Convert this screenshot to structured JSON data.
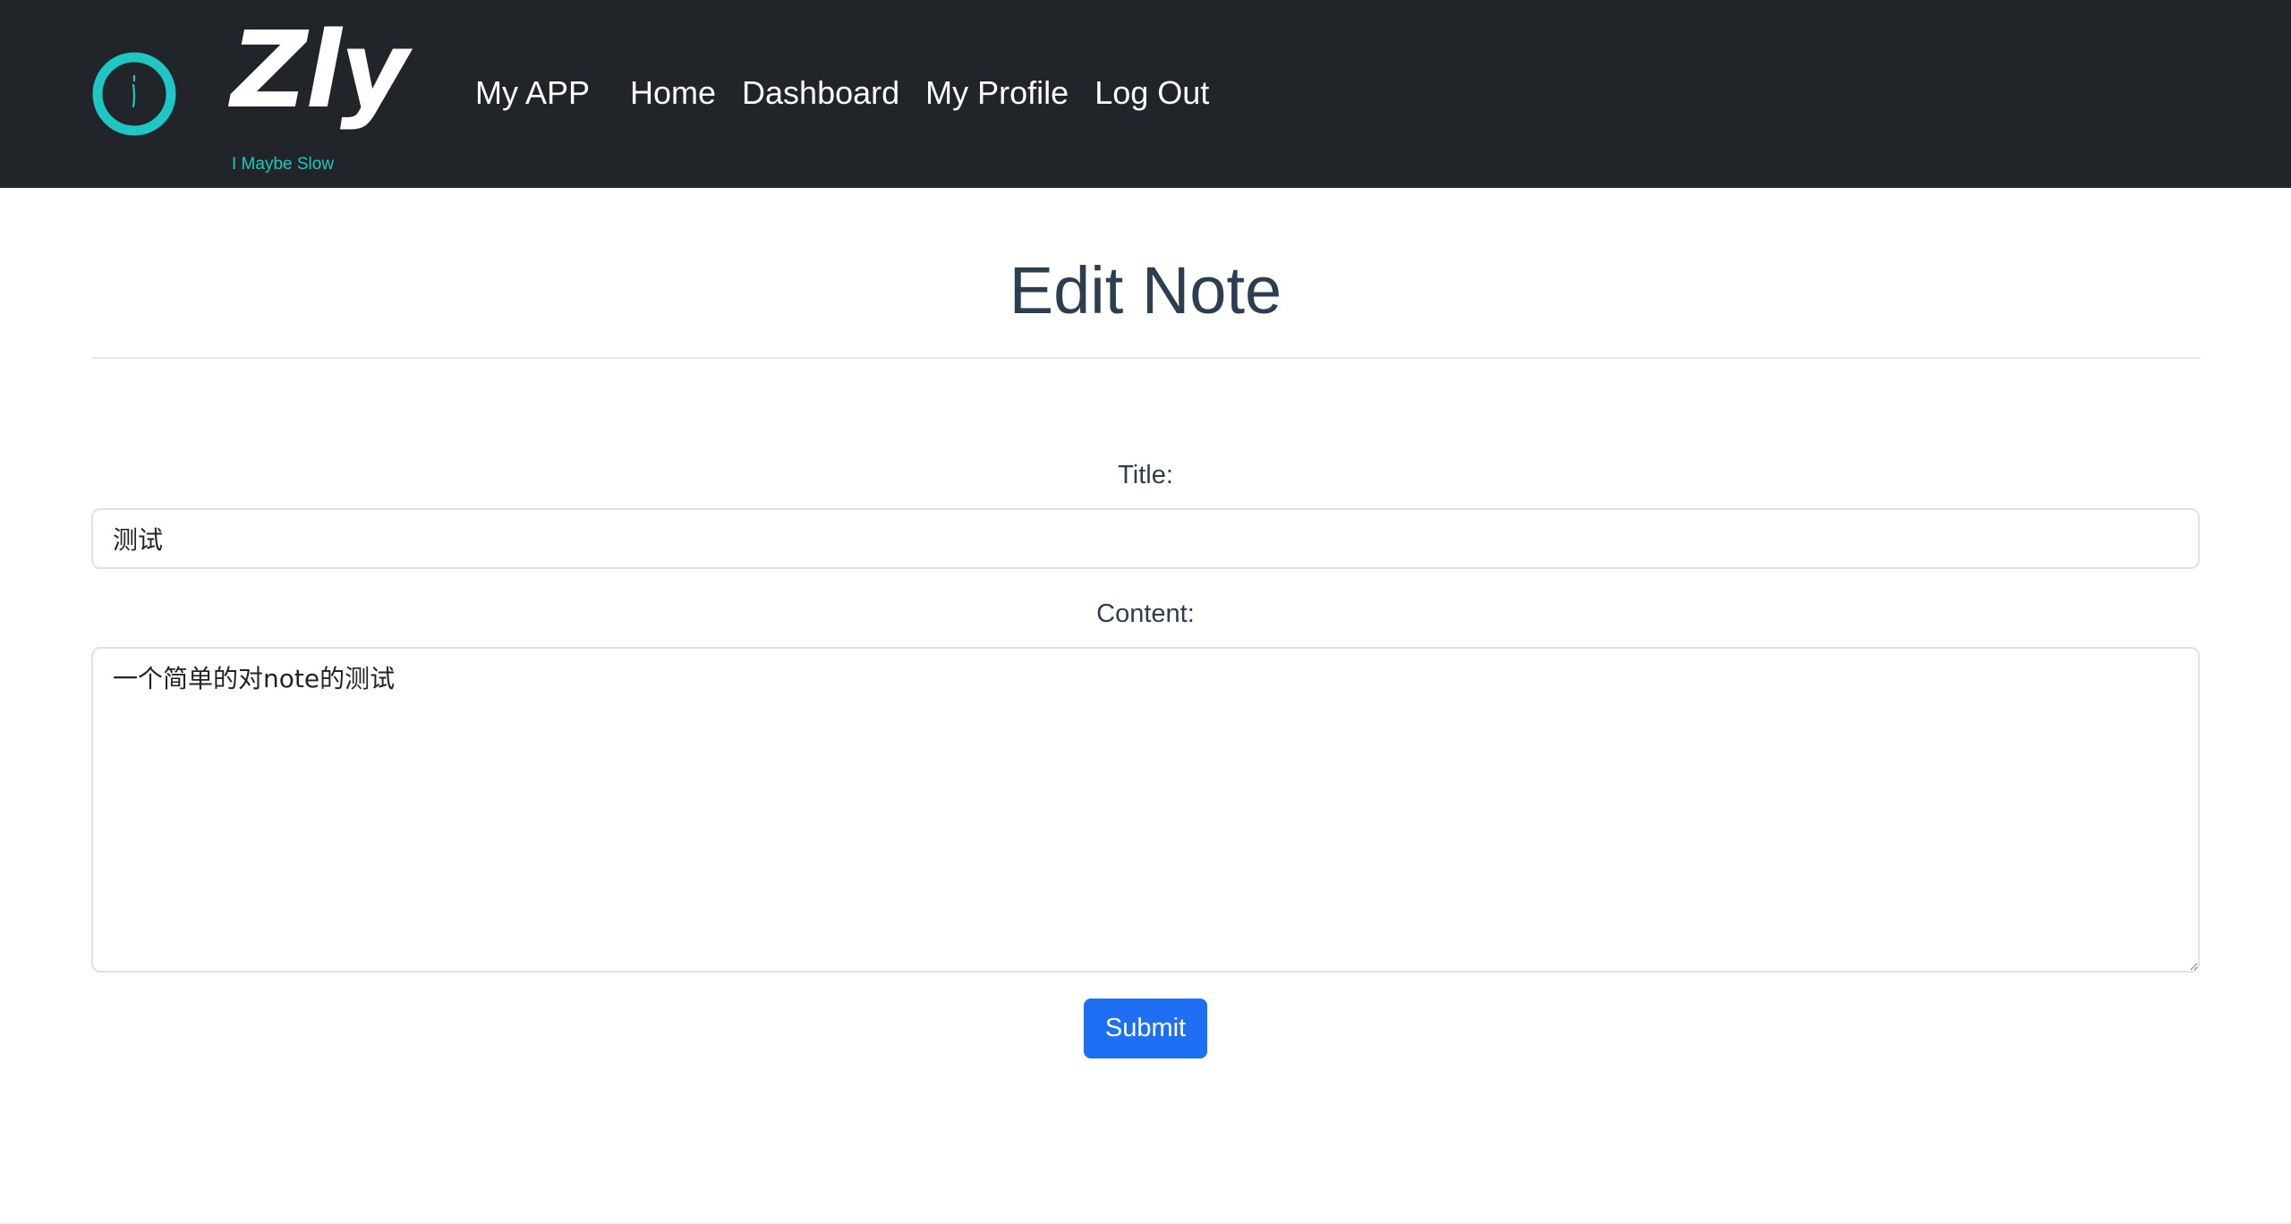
{
  "navbar": {
    "brand": "Zly",
    "tagline": "I Maybe Slow",
    "app_label": "My APP",
    "links": [
      {
        "label": "Home"
      },
      {
        "label": "Dashboard"
      },
      {
        "label": "My Profile"
      },
      {
        "label": "Log Out"
      }
    ],
    "background": "#212529",
    "accent": "#1fc7c2"
  },
  "page": {
    "title": "Edit Note"
  },
  "form": {
    "title_label": "Title:",
    "title_value": "测试",
    "content_label": "Content:",
    "content_value": "一个简单的对note的测试",
    "submit_label": "Submit",
    "submit_color": "#1f6ff5"
  },
  "icons": {
    "logo": "ring-logo-icon"
  }
}
